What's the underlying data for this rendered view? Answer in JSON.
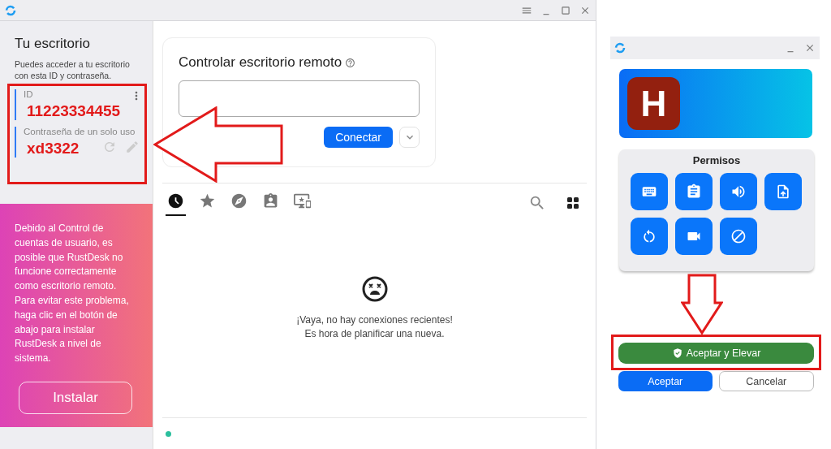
{
  "main_window": {
    "sidebar": {
      "title": "Tu escritorio",
      "description": "Puedes acceder a tu escritorio con esta ID y contraseña.",
      "id_label": "ID",
      "id_value": "11223334455",
      "password_label": "Contraseña de un solo uso",
      "password_value": "xd3322",
      "notice": "Debido al Control de cuentas de usuario, es posible que RustDesk no funcione correctamente como escritorio remoto. Para evitar este problema, haga clic en el botón de abajo para instalar RustDesk a nivel de sistema.",
      "install_button": "Instalar"
    },
    "connect_card": {
      "title": "Controlar escritorio remoto",
      "connect_button": "Conectar"
    },
    "tabs": [
      {
        "kind": "recent",
        "selected": true
      },
      {
        "kind": "favorites",
        "selected": false
      },
      {
        "kind": "discovered",
        "selected": false
      },
      {
        "kind": "address_book",
        "selected": false
      },
      {
        "kind": "group",
        "selected": false
      }
    ],
    "empty_state": {
      "line_1": "¡Vaya, no hay conexiones recientes!",
      "line_2": "Es hora de planificar una nueva."
    }
  },
  "dialog": {
    "avatar_letter": "H",
    "permissions_title": "Permisos",
    "accept_elevate_button": "Aceptar y Elevar",
    "accept_button": "Aceptar",
    "cancel_button": "Cancelar"
  }
}
